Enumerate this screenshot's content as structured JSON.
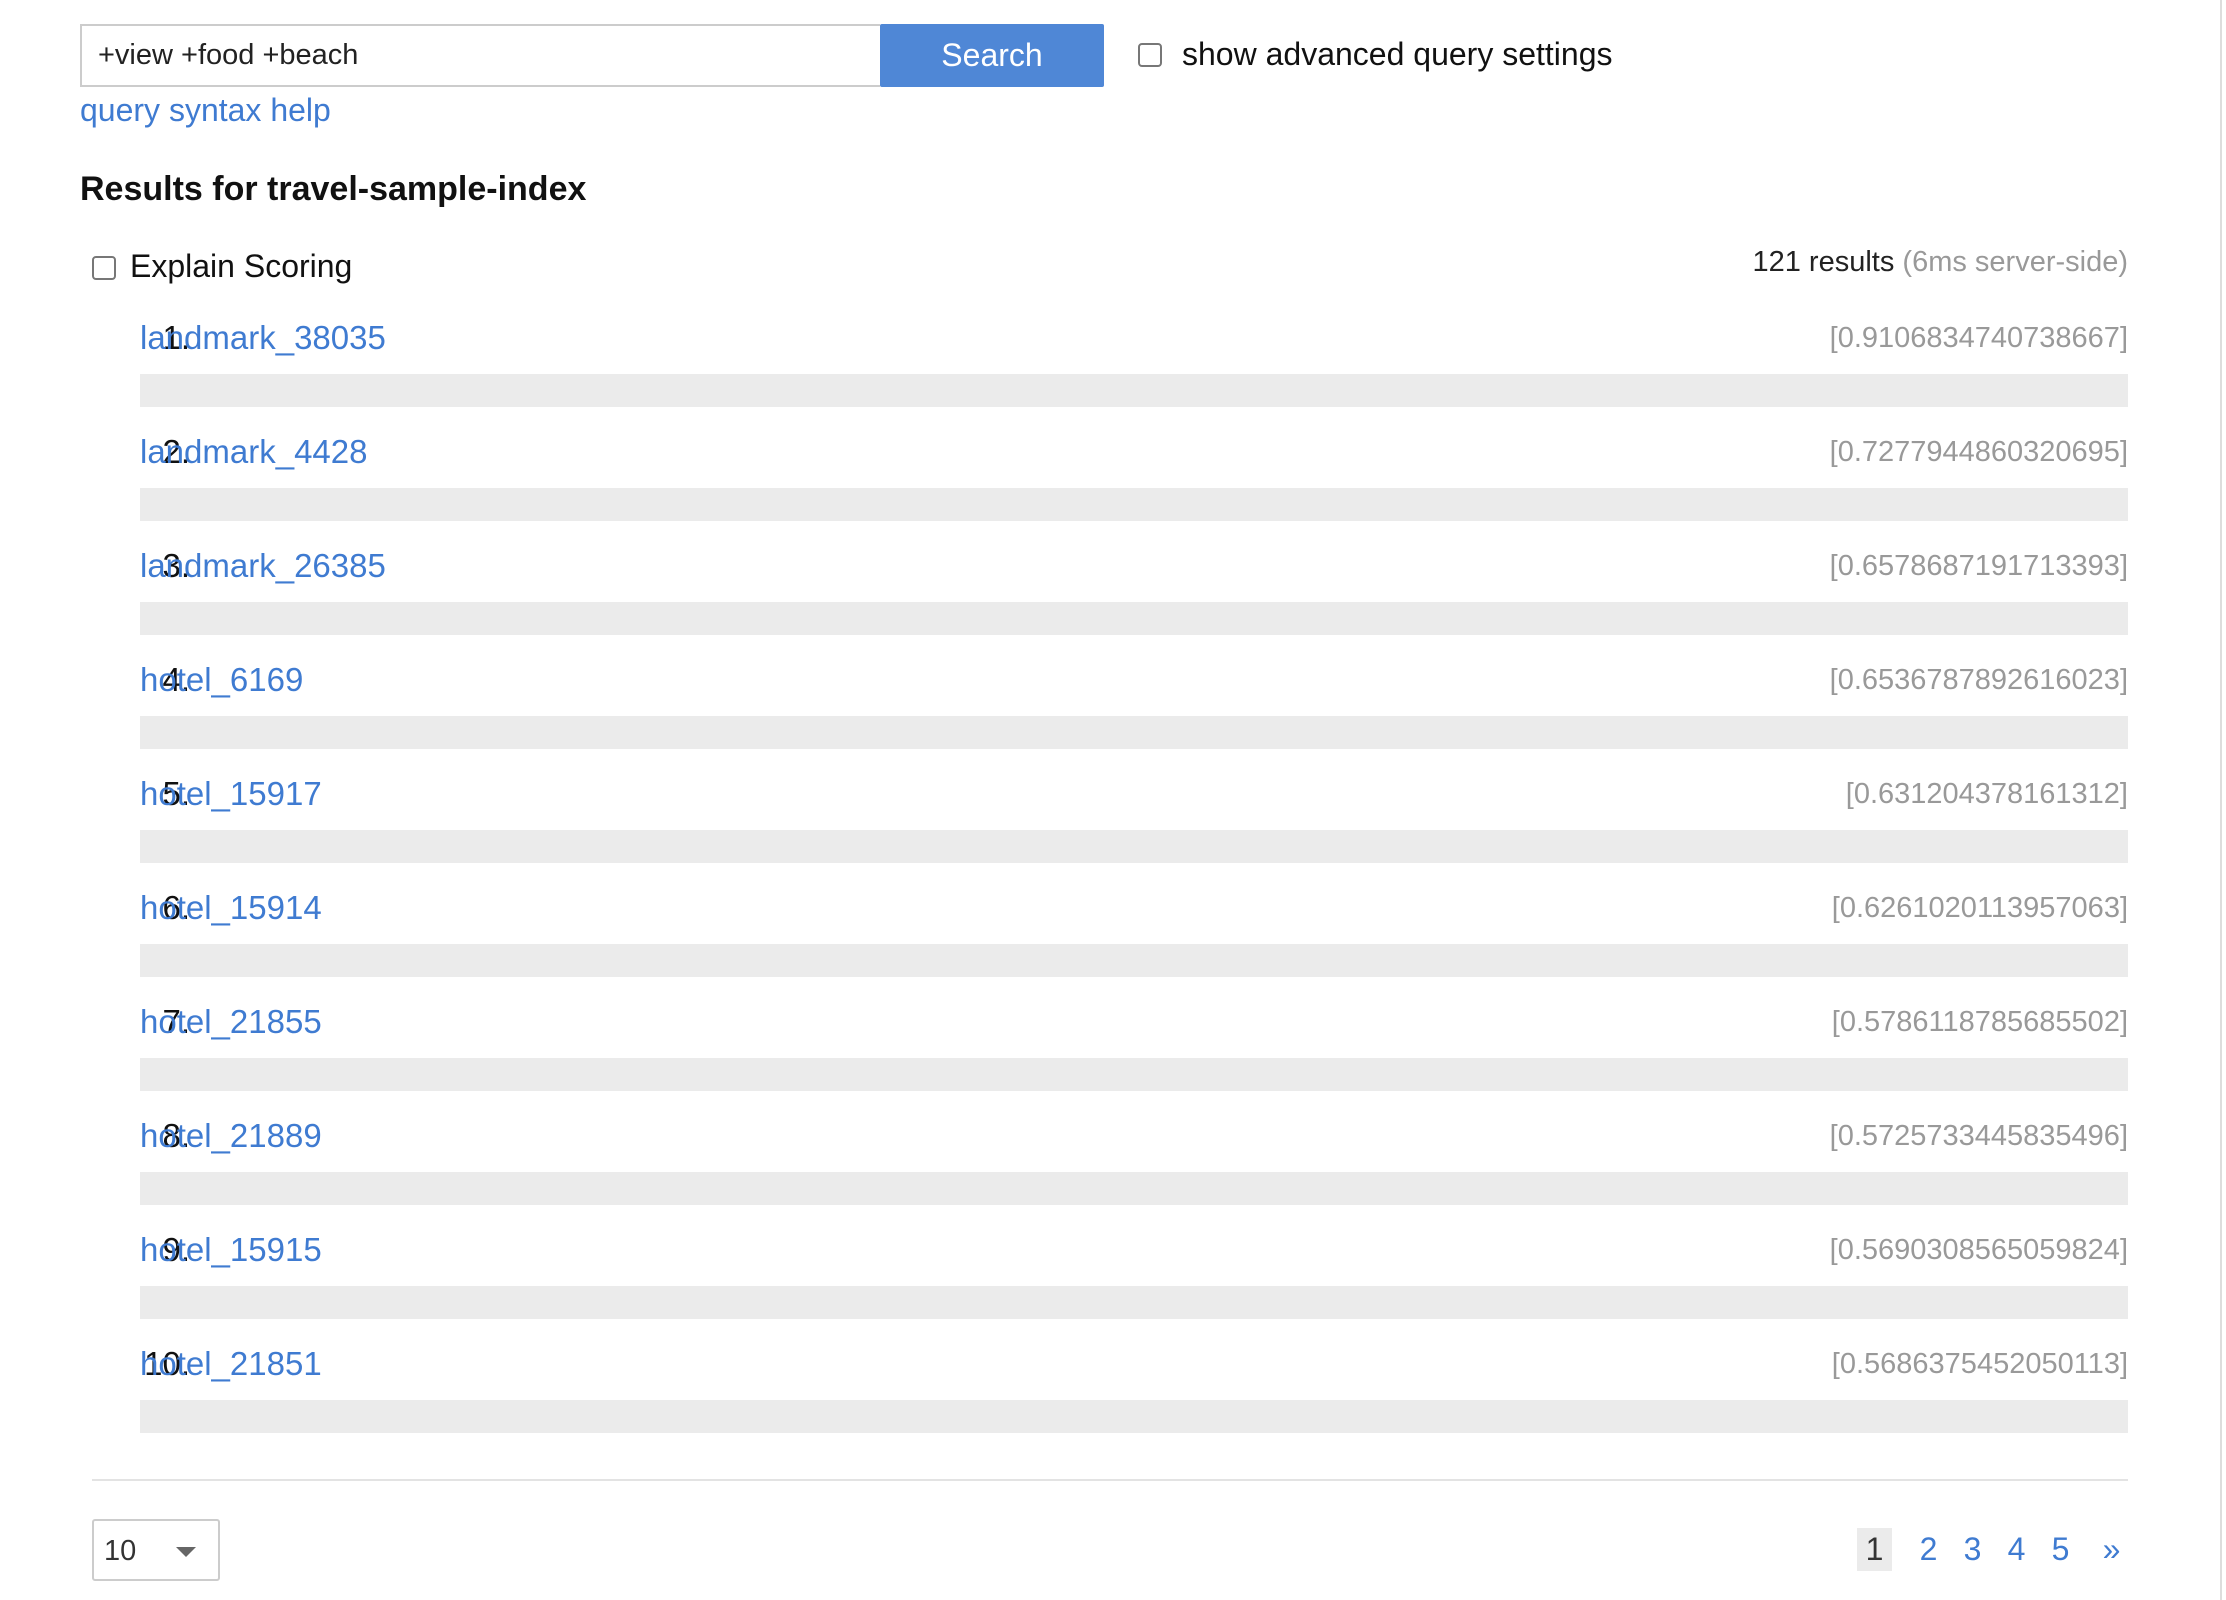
{
  "search": {
    "query": "+view +food +beach",
    "button_label": "Search",
    "advanced_label": "show advanced query settings",
    "advanced_checked": false,
    "syntax_help": "query syntax help"
  },
  "results": {
    "heading": "Results for travel-sample-index",
    "explain_label": "Explain Scoring",
    "explain_checked": false,
    "count": "121 results",
    "server_time": "(6ms server-side)",
    "items": [
      {
        "num": "1.",
        "name": "landmark_38035",
        "score": "[0.9106834740738667]"
      },
      {
        "num": "2.",
        "name": "landmark_4428",
        "score": "[0.7277944860320695]"
      },
      {
        "num": "3.",
        "name": "landmark_26385",
        "score": "[0.6578687191713393]"
      },
      {
        "num": "4.",
        "name": "hotel_6169",
        "score": "[0.6536787892616023]"
      },
      {
        "num": "5.",
        "name": "hotel_15917",
        "score": "[0.631204378161312]"
      },
      {
        "num": "6.",
        "name": "hotel_15914",
        "score": "[0.6261020113957063]"
      },
      {
        "num": "7.",
        "name": "hotel_21855",
        "score": "[0.5786118785685502]"
      },
      {
        "num": "8.",
        "name": "hotel_21889",
        "score": "[0.5725733445835496]"
      },
      {
        "num": "9.",
        "name": "hotel_15915",
        "score": "[0.5690308565059824]"
      },
      {
        "num": "10.",
        "name": "hotel_21851",
        "score": "[0.5686375452050113]"
      }
    ]
  },
  "pagination": {
    "page_size": "10",
    "pages": [
      "1",
      "2",
      "3",
      "4",
      "5"
    ],
    "current": "1",
    "next": "»"
  },
  "colors": {
    "accent": "#4f87d6",
    "link": "#3f7bd1",
    "score": "#999999",
    "bar": "#ebebeb"
  }
}
